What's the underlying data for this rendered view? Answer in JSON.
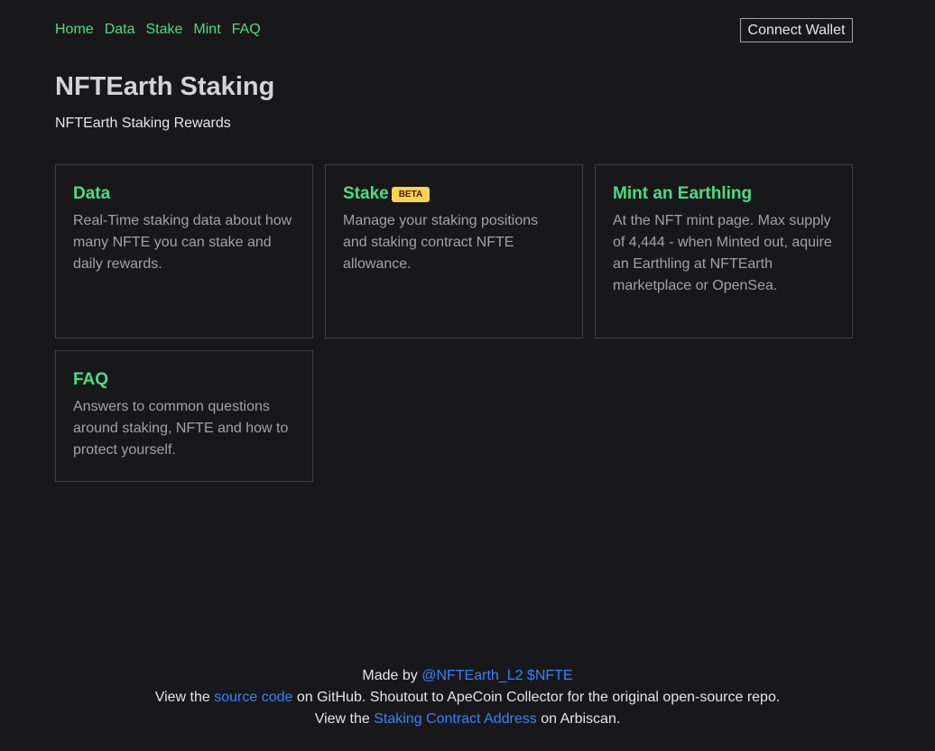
{
  "nav": {
    "items": [
      {
        "label": "Home"
      },
      {
        "label": "Data"
      },
      {
        "label": "Stake"
      },
      {
        "label": "Mint"
      },
      {
        "label": "FAQ"
      }
    ],
    "connect_label": "Connect Wallet"
  },
  "header": {
    "title": "NFTEarth Staking",
    "subtitle": "NFTEarth Staking Rewards"
  },
  "cards": [
    {
      "title": "Data",
      "description": "Real-Time staking data about how many NFTE you can stake and daily rewards."
    },
    {
      "title": "Stake",
      "badge": "BETA",
      "description": "Manage your staking positions and staking contract NFTE allowance."
    },
    {
      "title": "Mint an Earthling",
      "description": "At the NFT mint page. Max supply of 4,444 - when Minted out, aquire an Earthling at NFTEarth marketplace or OpenSea."
    },
    {
      "title": "FAQ",
      "description": "Answers to common questions around staking, NFTE and how to protect yourself."
    }
  ],
  "footer": {
    "line1_prefix": "Made by ",
    "line1_link": "@NFTEarth_L2 $NFTE",
    "line2_prefix": "View the ",
    "line2_link": "source code",
    "line2_suffix": " on GitHub. Shoutout to ApeCoin Collector for the original open-source repo.",
    "line3_prefix": "View the ",
    "line3_link": "Staking Contract Address",
    "line3_suffix": " on Arbiscan."
  },
  "colors": {
    "background": "#18181b",
    "accent_green": "#4ade80",
    "link_blue": "#3b82f6",
    "badge_yellow": "#fcd34d",
    "card_border": "#3f3f46"
  }
}
